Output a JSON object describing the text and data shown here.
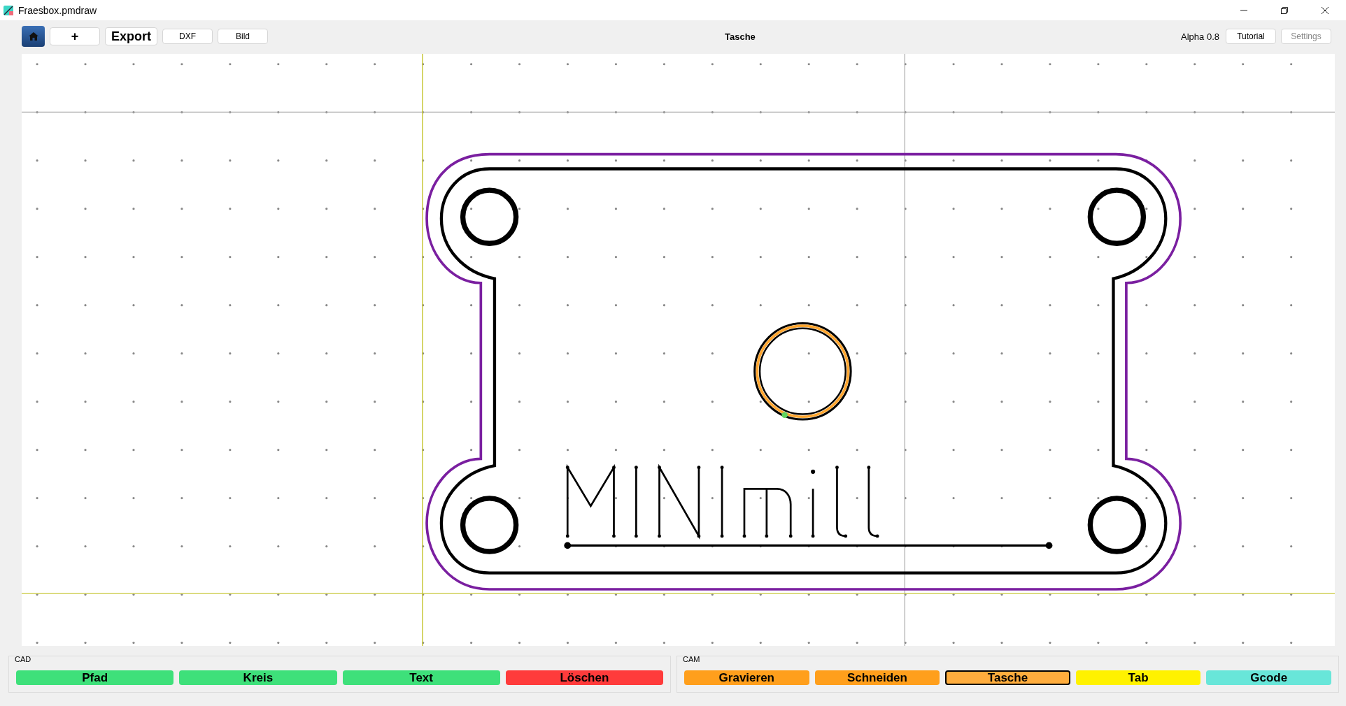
{
  "window": {
    "title": "Fraesbox.pmdraw"
  },
  "toolbar": {
    "buttons": [
      {
        "label": "+",
        "kind": "plain"
      },
      {
        "label": "Export",
        "kind": "bold"
      },
      {
        "label": "DXF",
        "kind": "small"
      },
      {
        "label": "Bild",
        "kind": "small"
      }
    ],
    "mode": "Tasche",
    "version": "Alpha 0.8",
    "right_buttons": [
      {
        "label": "Tutorial",
        "disabled": false
      },
      {
        "label": "Settings",
        "disabled": true
      }
    ]
  },
  "groups": [
    {
      "title": "CAD",
      "buttons": [
        {
          "label": "Pfad",
          "color": "#3ee07a",
          "selected": false
        },
        {
          "label": "Kreis",
          "color": "#3ee07a",
          "selected": false
        },
        {
          "label": "Text",
          "color": "#3ee07a",
          "selected": false
        },
        {
          "label": "Löschen",
          "color": "#ff3b3b",
          "selected": false
        }
      ]
    },
    {
      "title": "CAM",
      "buttons": [
        {
          "label": "Gravieren",
          "color": "#ff9f1c",
          "selected": false
        },
        {
          "label": "Schneiden",
          "color": "#ff9f1c",
          "selected": false
        },
        {
          "label": "Tasche",
          "color": "#ffad3d",
          "selected": true
        },
        {
          "label": "Tab",
          "color": "#fff200",
          "selected": false
        },
        {
          "label": "Gcode",
          "color": "#68e6d9",
          "selected": false
        }
      ]
    }
  ]
}
